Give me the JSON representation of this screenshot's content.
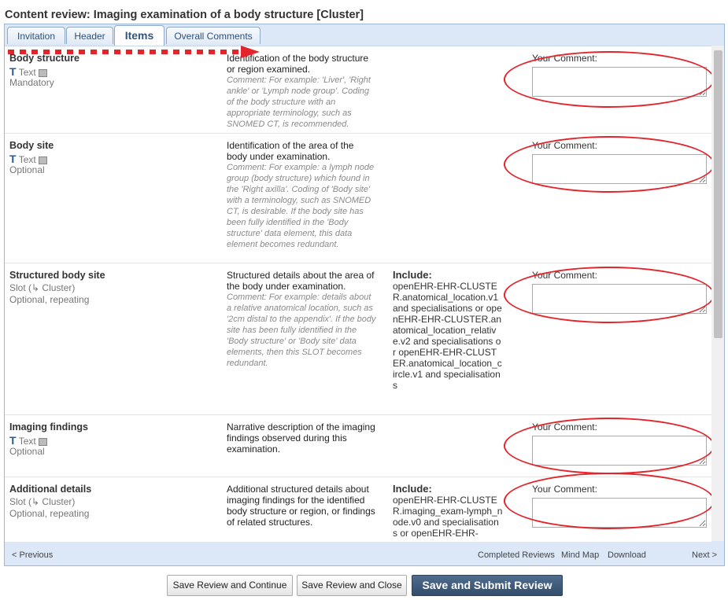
{
  "page": {
    "title": "Content review: Imaging examination of a body structure [Cluster]"
  },
  "tabs": [
    {
      "label": "Invitation"
    },
    {
      "label": "Header"
    },
    {
      "label": "Items"
    },
    {
      "label": "Overall Comments"
    }
  ],
  "items": [
    {
      "name": "Body structure",
      "type_label": "Text",
      "occurrence": "Mandatory",
      "description": "Identification of the body structure or region examined.",
      "comment": "Comment: For example: 'Liver', 'Right ankle' or 'Lymph node group'. Coding of the body structure with an appropriate terminology, such as SNOMED CT, is recommended.",
      "your_comment_label": "Your Comment:"
    },
    {
      "name": "Body site",
      "type_label": "Text",
      "occurrence": "Optional",
      "description": "Identification of the area of the body under examination.",
      "comment": "Comment: For example: a lymph node group (body structure) which found in the 'Right axilla'. Coding of 'Body site' with a terminology, such as SNOMED CT, is desirable. If the body site has been fully identified in the 'Body structure' data element, this data element becomes redundant.",
      "your_comment_label": "Your Comment:"
    },
    {
      "name": "Structured body site",
      "type_label": "Slot (↳ Cluster)",
      "occurrence": "Optional, repeating",
      "description": "Structured details about the area of the body under examination.",
      "comment": "Comment: For example: details about a relative anatomical location, such as '2cm distal to the appendix'. If the body site has been fully identified in the 'Body structure' or 'Body site' data elements, then this SLOT becomes redundant.",
      "include_label": "Include:",
      "include_text": "openEHR-EHR-CLUSTER.anatomical_location.v1 and specialisations or openEHR-EHR-CLUSTER.anatomical_location_relative.v2 and specialisations or openEHR-EHR-CLUSTER.anatomical_location_circle.v1 and specialisations",
      "your_comment_label": "Your Comment:"
    },
    {
      "name": "Imaging findings",
      "type_label": "Text",
      "occurrence": "Optional",
      "description": "Narrative description of the imaging findings observed during this examination.",
      "your_comment_label": "Your Comment:"
    },
    {
      "name": "Additional details",
      "type_label": "Slot (↳ Cluster)",
      "occurrence": "Optional, repeating",
      "description": "Additional structured details about imaging findings for the identified body structure or region, or findings of related structures.",
      "include_label": "Include:",
      "include_text": "openEHR-EHR-CLUSTER.imaging_exam-lymph_node.v0 and specialisations or openEHR-EHR-",
      "your_comment_label": "Your Comment:"
    }
  ],
  "footer": {
    "previous": "< Previous",
    "completed_reviews": "Completed Reviews",
    "mind_map": "Mind Map",
    "download": "Download",
    "next": "Next >"
  },
  "buttons": {
    "save_continue": "Save Review and Continue",
    "save_close": "Save Review and Close",
    "save_submit": "Save and Submit Review"
  },
  "colors": {
    "annotation_red": "#e3242b",
    "panel_blue": "#dce8f7",
    "primary_button": "#3c5878"
  }
}
